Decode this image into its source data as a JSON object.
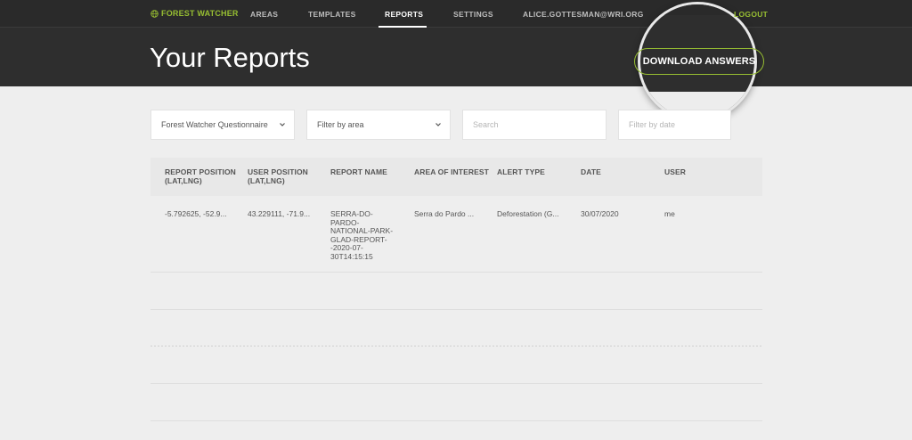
{
  "nav": {
    "brand": "FOREST WATCHER",
    "items": [
      "AREAS",
      "TEMPLATES",
      "REPORTS",
      "SETTINGS"
    ],
    "user_email": "ALICE.GOTTESMAN@WRI.ORG",
    "logout": "LOGOUT"
  },
  "page": {
    "title": "Your Reports",
    "download_label": "DOWNLOAD ANSWERS"
  },
  "filters": {
    "template_select": "Forest Watcher Questionnaire",
    "area_select_placeholder": "Filter by area",
    "search_placeholder": "Search",
    "date_placeholder": "Filter by date"
  },
  "table": {
    "headers": [
      "REPORT POSITION\n(LAT,LNG)",
      "USER POSITION\n(LAT,LNG)",
      "REPORT NAME",
      "AREA OF INTEREST",
      "ALERT TYPE",
      "DATE",
      "USER"
    ],
    "rows": [
      {
        "report_position": "-5.792625, -52.9...",
        "user_position": "43.229111, -71.9...",
        "report_name": "SERRA-DO-\nPARDO-\nNATIONAL-PARK-\nGLAD-REPORT-\n-2020-07-\n30T14:15:15",
        "area": "Serra do Pardo ...",
        "alert_type": "Deforestation (G...",
        "date": "30/07/2020",
        "user": "me"
      }
    ]
  },
  "colors": {
    "brand_green": "#97be32",
    "header_bg": "#2e2e2e",
    "page_bg": "#eeeeee"
  }
}
